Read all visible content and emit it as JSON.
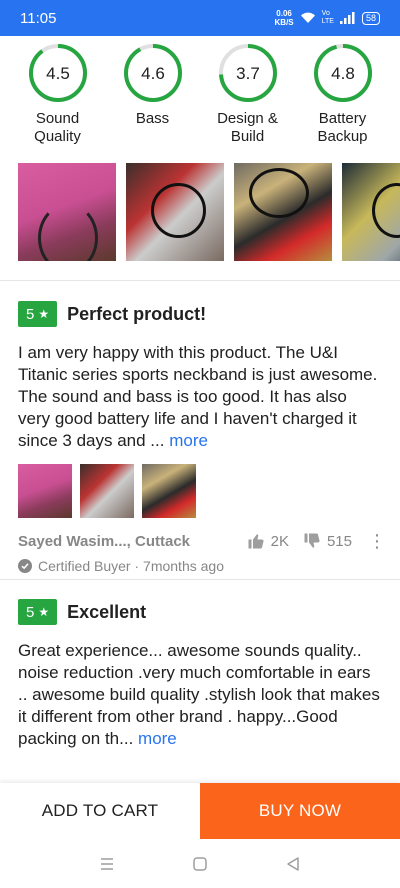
{
  "status_bar": {
    "time": "11:05",
    "net_speed": "0.06",
    "net_unit": "KB/S",
    "volte_top": "Vo",
    "volte_bottom": "LTE",
    "battery": "58"
  },
  "ratings": [
    {
      "value": "4.5",
      "fraction": 0.9,
      "label_lines": [
        "Sound",
        "Quality"
      ]
    },
    {
      "value": "4.6",
      "fraction": 0.92,
      "label_lines": [
        "Bass",
        ""
      ]
    },
    {
      "value": "3.7",
      "fraction": 0.74,
      "label_lines": [
        "Design &",
        "Build"
      ]
    },
    {
      "value": "4.8",
      "fraction": 0.96,
      "label_lines": [
        "Battery",
        "Backup"
      ]
    }
  ],
  "reviews": [
    {
      "rating": "5",
      "title": "Perfect product!",
      "body": "I am very happy with this product. The U&I Titanic series sports neckband is just awesome. The sound and bass is too good. It has also very good battery life and I haven't charged it since 3 days and ... ",
      "more": "more",
      "author": "Sayed Wasim..., Cuttack",
      "likes": "2K",
      "dislikes": "515",
      "certified": "Certified Buyer · 7months ago"
    },
    {
      "rating": "5",
      "title": "Excellent",
      "body": "Great experience... awesome sounds quality.. noise reduction .very much comfortable in ears .. awesome build quality .stylish look that makes it different from other brand . happy...Good packing on th... ",
      "more": "more"
    }
  ],
  "actions": {
    "add_to_cart": "ADD TO CART",
    "buy_now": "BUY NOW"
  },
  "colors": {
    "brand_blue": "#2874f0",
    "rating_green": "#26a541",
    "buy_orange": "#fb641b"
  },
  "icons": {
    "like": "thumbs-up-icon",
    "dislike": "thumbs-down-icon",
    "menu": "kebab-menu-icon",
    "certified": "check-circle-icon",
    "wifi": "wifi-icon",
    "signal": "signal-icon",
    "nav": [
      "menu-icon",
      "home-icon",
      "back-icon"
    ]
  }
}
